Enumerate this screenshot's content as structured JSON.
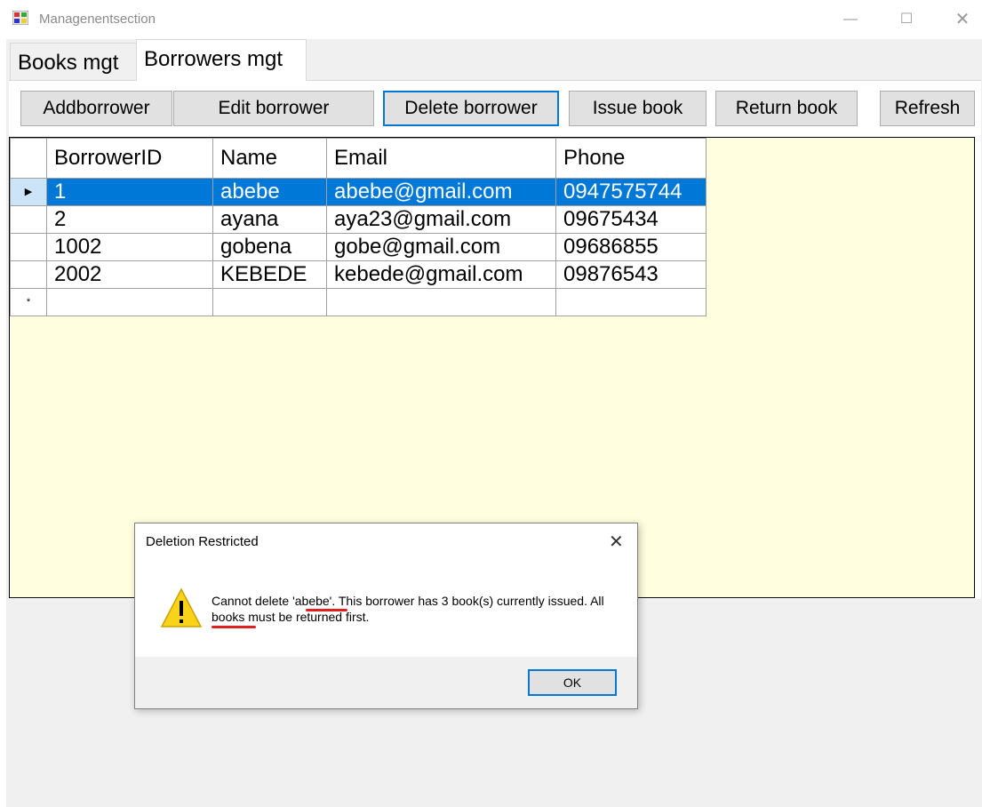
{
  "window": {
    "title": "Managenentsection",
    "minimize_glyph": "—",
    "maximize_glyph": "☐",
    "close_glyph": "✕"
  },
  "tabs": [
    {
      "label": "Books mgt",
      "selected": false
    },
    {
      "label": "Borrowers mgt",
      "selected": true
    }
  ],
  "toolbar": {
    "add_label": "Addborrower",
    "edit_label": "Edit borrower",
    "delete_label": "Delete borrower",
    "issue_label": "Issue book",
    "return_label": "Return book",
    "refresh_label": "Refresh"
  },
  "grid": {
    "columns": [
      "BorrowerID",
      "Name",
      "Email",
      "Phone"
    ],
    "rows": [
      {
        "id": "1",
        "name": "abebe",
        "email": "abebe@gmail.com",
        "phone": "0947575744",
        "selected": true,
        "marker": "▶"
      },
      {
        "id": "2",
        "name": "ayana",
        "email": "aya23@gmail.com",
        "phone": "09675434",
        "selected": false,
        "marker": ""
      },
      {
        "id": "1002",
        "name": "gobena",
        "email": "gobe@gmail.com",
        "phone": "09686855",
        "selected": false,
        "marker": ""
      },
      {
        "id": "2002",
        "name": "KEBEDE",
        "email": "kebede@gmail.com",
        "phone": "09876543",
        "selected": false,
        "marker": ""
      }
    ],
    "new_row_marker": "*"
  },
  "dialog": {
    "title": "Deletion Restricted",
    "close_glyph": "✕",
    "message": "Cannot delete 'abebe'. This borrower has 3 book(s) currently issued. All books must be returned first.",
    "ok_label": "OK",
    "icon": "warning-icon"
  },
  "colors": {
    "selection": "#0078d7",
    "grid_background": "#ffffe0",
    "annotation_underline": "#e02020"
  }
}
